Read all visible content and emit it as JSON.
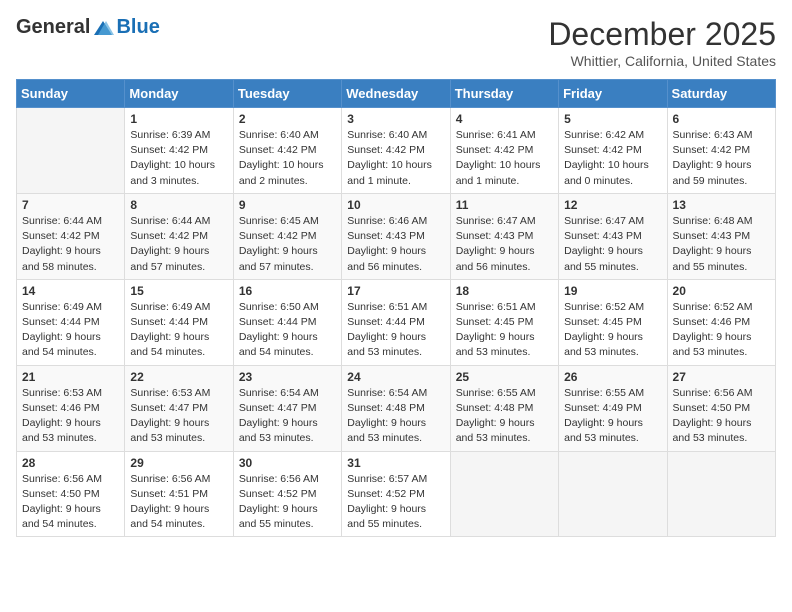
{
  "header": {
    "logo_general": "General",
    "logo_blue": "Blue",
    "month": "December 2025",
    "location": "Whittier, California, United States"
  },
  "weekdays": [
    "Sunday",
    "Monday",
    "Tuesday",
    "Wednesday",
    "Thursday",
    "Friday",
    "Saturday"
  ],
  "weeks": [
    [
      {
        "day": "",
        "info": ""
      },
      {
        "day": "1",
        "info": "Sunrise: 6:39 AM\nSunset: 4:42 PM\nDaylight: 10 hours\nand 3 minutes."
      },
      {
        "day": "2",
        "info": "Sunrise: 6:40 AM\nSunset: 4:42 PM\nDaylight: 10 hours\nand 2 minutes."
      },
      {
        "day": "3",
        "info": "Sunrise: 6:40 AM\nSunset: 4:42 PM\nDaylight: 10 hours\nand 1 minute."
      },
      {
        "day": "4",
        "info": "Sunrise: 6:41 AM\nSunset: 4:42 PM\nDaylight: 10 hours\nand 1 minute."
      },
      {
        "day": "5",
        "info": "Sunrise: 6:42 AM\nSunset: 4:42 PM\nDaylight: 10 hours\nand 0 minutes."
      },
      {
        "day": "6",
        "info": "Sunrise: 6:43 AM\nSunset: 4:42 PM\nDaylight: 9 hours\nand 59 minutes."
      }
    ],
    [
      {
        "day": "7",
        "info": "Sunrise: 6:44 AM\nSunset: 4:42 PM\nDaylight: 9 hours\nand 58 minutes."
      },
      {
        "day": "8",
        "info": "Sunrise: 6:44 AM\nSunset: 4:42 PM\nDaylight: 9 hours\nand 57 minutes."
      },
      {
        "day": "9",
        "info": "Sunrise: 6:45 AM\nSunset: 4:42 PM\nDaylight: 9 hours\nand 57 minutes."
      },
      {
        "day": "10",
        "info": "Sunrise: 6:46 AM\nSunset: 4:43 PM\nDaylight: 9 hours\nand 56 minutes."
      },
      {
        "day": "11",
        "info": "Sunrise: 6:47 AM\nSunset: 4:43 PM\nDaylight: 9 hours\nand 56 minutes."
      },
      {
        "day": "12",
        "info": "Sunrise: 6:47 AM\nSunset: 4:43 PM\nDaylight: 9 hours\nand 55 minutes."
      },
      {
        "day": "13",
        "info": "Sunrise: 6:48 AM\nSunset: 4:43 PM\nDaylight: 9 hours\nand 55 minutes."
      }
    ],
    [
      {
        "day": "14",
        "info": "Sunrise: 6:49 AM\nSunset: 4:44 PM\nDaylight: 9 hours\nand 54 minutes."
      },
      {
        "day": "15",
        "info": "Sunrise: 6:49 AM\nSunset: 4:44 PM\nDaylight: 9 hours\nand 54 minutes."
      },
      {
        "day": "16",
        "info": "Sunrise: 6:50 AM\nSunset: 4:44 PM\nDaylight: 9 hours\nand 54 minutes."
      },
      {
        "day": "17",
        "info": "Sunrise: 6:51 AM\nSunset: 4:44 PM\nDaylight: 9 hours\nand 53 minutes."
      },
      {
        "day": "18",
        "info": "Sunrise: 6:51 AM\nSunset: 4:45 PM\nDaylight: 9 hours\nand 53 minutes."
      },
      {
        "day": "19",
        "info": "Sunrise: 6:52 AM\nSunset: 4:45 PM\nDaylight: 9 hours\nand 53 minutes."
      },
      {
        "day": "20",
        "info": "Sunrise: 6:52 AM\nSunset: 4:46 PM\nDaylight: 9 hours\nand 53 minutes."
      }
    ],
    [
      {
        "day": "21",
        "info": "Sunrise: 6:53 AM\nSunset: 4:46 PM\nDaylight: 9 hours\nand 53 minutes."
      },
      {
        "day": "22",
        "info": "Sunrise: 6:53 AM\nSunset: 4:47 PM\nDaylight: 9 hours\nand 53 minutes."
      },
      {
        "day": "23",
        "info": "Sunrise: 6:54 AM\nSunset: 4:47 PM\nDaylight: 9 hours\nand 53 minutes."
      },
      {
        "day": "24",
        "info": "Sunrise: 6:54 AM\nSunset: 4:48 PM\nDaylight: 9 hours\nand 53 minutes."
      },
      {
        "day": "25",
        "info": "Sunrise: 6:55 AM\nSunset: 4:48 PM\nDaylight: 9 hours\nand 53 minutes."
      },
      {
        "day": "26",
        "info": "Sunrise: 6:55 AM\nSunset: 4:49 PM\nDaylight: 9 hours\nand 53 minutes."
      },
      {
        "day": "27",
        "info": "Sunrise: 6:56 AM\nSunset: 4:50 PM\nDaylight: 9 hours\nand 53 minutes."
      }
    ],
    [
      {
        "day": "28",
        "info": "Sunrise: 6:56 AM\nSunset: 4:50 PM\nDaylight: 9 hours\nand 54 minutes."
      },
      {
        "day": "29",
        "info": "Sunrise: 6:56 AM\nSunset: 4:51 PM\nDaylight: 9 hours\nand 54 minutes."
      },
      {
        "day": "30",
        "info": "Sunrise: 6:56 AM\nSunset: 4:52 PM\nDaylight: 9 hours\nand 55 minutes."
      },
      {
        "day": "31",
        "info": "Sunrise: 6:57 AM\nSunset: 4:52 PM\nDaylight: 9 hours\nand 55 minutes."
      },
      {
        "day": "",
        "info": ""
      },
      {
        "day": "",
        "info": ""
      },
      {
        "day": "",
        "info": ""
      }
    ]
  ]
}
